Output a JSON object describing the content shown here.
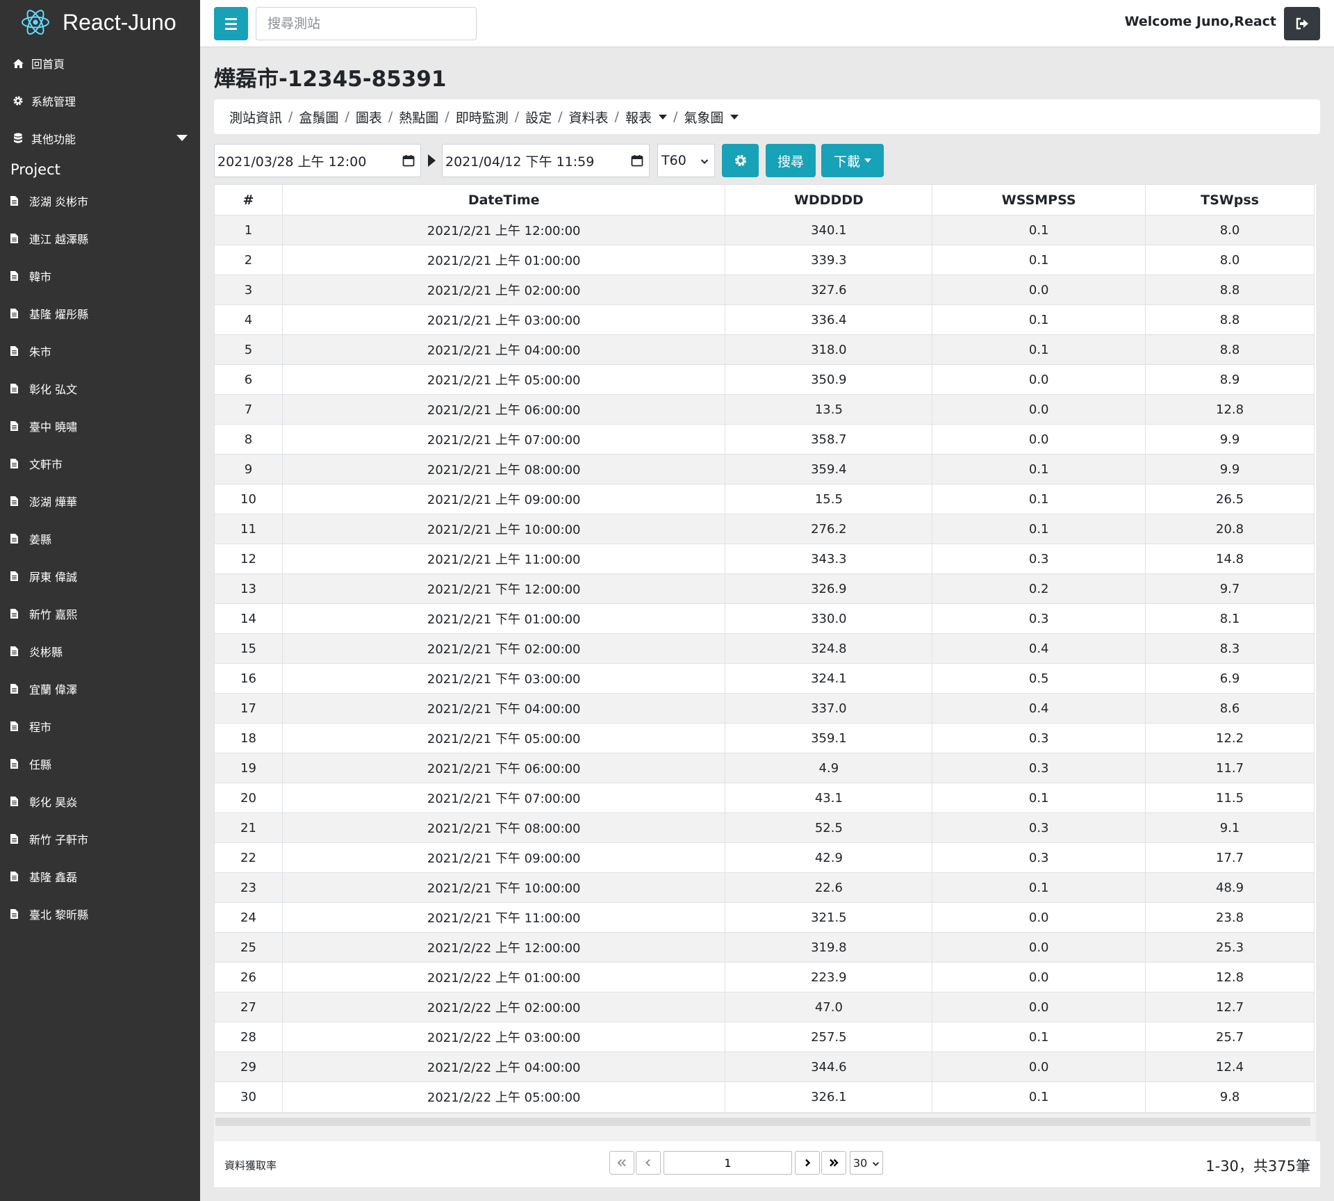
{
  "app": {
    "title": "React-Juno"
  },
  "sidebar": {
    "nav": [
      {
        "label": "回首頁",
        "icon": "home-icon"
      },
      {
        "label": "系統管理",
        "icon": "gear-icon"
      },
      {
        "label": "其他功能",
        "icon": "database-icon"
      }
    ],
    "project_label": "Project",
    "stations": [
      "澎湖 炎彬市",
      "連江 越澤縣",
      "韓市",
      "基隆 燿彤縣",
      "朱市",
      "彰化 弘文",
      "臺中 曉嘯",
      "文軒市",
      "澎湖 燁華",
      "姜縣",
      "屏東 偉誠",
      "新竹 嘉熙",
      "炎彬縣",
      "宜蘭 偉澤",
      "程市",
      "任縣",
      "彰化 昊焱",
      "新竹 子軒市",
      "基隆 鑫磊",
      "臺北 黎昕縣"
    ]
  },
  "topbar": {
    "search_placeholder": "搜尋測站",
    "welcome": "Welcome Juno,React"
  },
  "page": {
    "title": "燁磊市-12345-85391",
    "crumbs": [
      "測站資訊",
      "盒鬚圖",
      "圖表",
      "熱點圖",
      "即時監測",
      "設定",
      "資料表",
      "報表",
      "氣象圖"
    ]
  },
  "filters": {
    "start": "2021/03/28 上午 12:00",
    "end": "2021/04/12 下午 11:59",
    "interval": "T60",
    "search_label": "搜尋",
    "download_label": "下載"
  },
  "table": {
    "columns": [
      "#",
      "DateTime",
      "WDDDDD",
      "WSSMPSS",
      "TSWpss"
    ],
    "rows": [
      [
        "1",
        "2021/2/21 上午 12:00:00",
        "340.1",
        "0.1",
        "8.0"
      ],
      [
        "2",
        "2021/2/21 上午 01:00:00",
        "339.3",
        "0.1",
        "8.0"
      ],
      [
        "3",
        "2021/2/21 上午 02:00:00",
        "327.6",
        "0.0",
        "8.8"
      ],
      [
        "4",
        "2021/2/21 上午 03:00:00",
        "336.4",
        "0.1",
        "8.8"
      ],
      [
        "5",
        "2021/2/21 上午 04:00:00",
        "318.0",
        "0.1",
        "8.8"
      ],
      [
        "6",
        "2021/2/21 上午 05:00:00",
        "350.9",
        "0.0",
        "8.9"
      ],
      [
        "7",
        "2021/2/21 上午 06:00:00",
        "13.5",
        "0.0",
        "12.8"
      ],
      [
        "8",
        "2021/2/21 上午 07:00:00",
        "358.7",
        "0.0",
        "9.9"
      ],
      [
        "9",
        "2021/2/21 上午 08:00:00",
        "359.4",
        "0.1",
        "9.9"
      ],
      [
        "10",
        "2021/2/21 上午 09:00:00",
        "15.5",
        "0.1",
        "26.5"
      ],
      [
        "11",
        "2021/2/21 上午 10:00:00",
        "276.2",
        "0.1",
        "20.8"
      ],
      [
        "12",
        "2021/2/21 上午 11:00:00",
        "343.3",
        "0.3",
        "14.8"
      ],
      [
        "13",
        "2021/2/21 下午 12:00:00",
        "326.9",
        "0.2",
        "9.7"
      ],
      [
        "14",
        "2021/2/21 下午 01:00:00",
        "330.0",
        "0.3",
        "8.1"
      ],
      [
        "15",
        "2021/2/21 下午 02:00:00",
        "324.8",
        "0.4",
        "8.3"
      ],
      [
        "16",
        "2021/2/21 下午 03:00:00",
        "324.1",
        "0.5",
        "6.9"
      ],
      [
        "17",
        "2021/2/21 下午 04:00:00",
        "337.0",
        "0.4",
        "8.6"
      ],
      [
        "18",
        "2021/2/21 下午 05:00:00",
        "359.1",
        "0.3",
        "12.2"
      ],
      [
        "19",
        "2021/2/21 下午 06:00:00",
        "4.9",
        "0.3",
        "11.7"
      ],
      [
        "20",
        "2021/2/21 下午 07:00:00",
        "43.1",
        "0.1",
        "11.5"
      ],
      [
        "21",
        "2021/2/21 下午 08:00:00",
        "52.5",
        "0.3",
        "9.1"
      ],
      [
        "22",
        "2021/2/21 下午 09:00:00",
        "42.9",
        "0.3",
        "17.7"
      ],
      [
        "23",
        "2021/2/21 下午 10:00:00",
        "22.6",
        "0.1",
        "48.9"
      ],
      [
        "24",
        "2021/2/21 下午 11:00:00",
        "321.5",
        "0.0",
        "23.8"
      ],
      [
        "25",
        "2021/2/22 上午 12:00:00",
        "319.8",
        "0.0",
        "25.3"
      ],
      [
        "26",
        "2021/2/22 上午 01:00:00",
        "223.9",
        "0.0",
        "12.8"
      ],
      [
        "27",
        "2021/2/22 上午 02:00:00",
        "47.0",
        "0.0",
        "12.7"
      ],
      [
        "28",
        "2021/2/22 上午 03:00:00",
        "257.5",
        "0.1",
        "25.7"
      ],
      [
        "29",
        "2021/2/22 上午 04:00:00",
        "344.6",
        "0.0",
        "12.4"
      ],
      [
        "30",
        "2021/2/22 上午 05:00:00",
        "326.1",
        "0.1",
        "9.8"
      ]
    ]
  },
  "footer": {
    "rate_label": "資料獲取率",
    "page_value": "1",
    "page_size": "30",
    "range_text": "1-30，共375筆"
  }
}
